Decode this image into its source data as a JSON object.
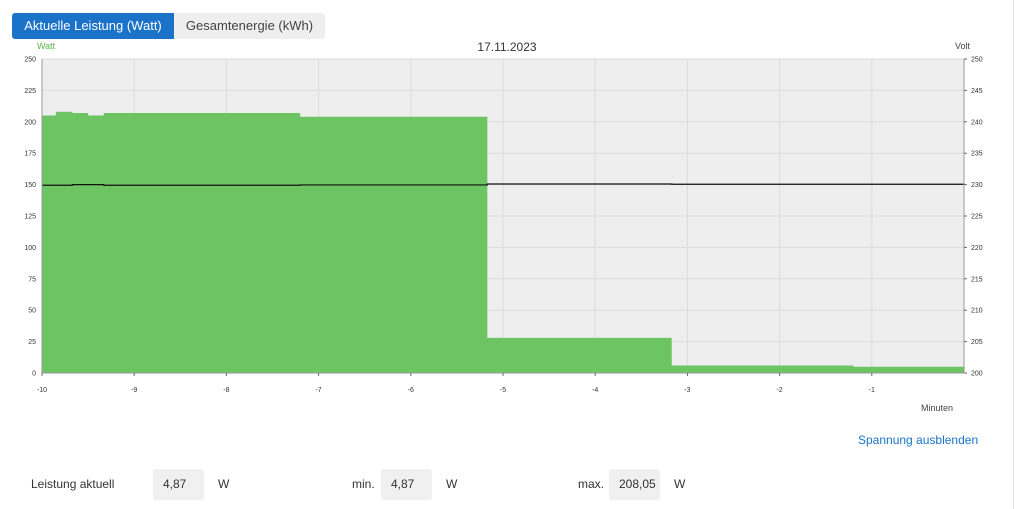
{
  "tabs": [
    {
      "label": "Aktuelle Leistung (Watt)",
      "active": true
    },
    {
      "label": "Gesamtenergie (kWh)",
      "active": false
    }
  ],
  "chart": {
    "title": "17.11.2023",
    "left_axis_label": "Watt",
    "right_axis_label": "Volt",
    "x_axis_label": "Minuten"
  },
  "chart_data": {
    "type": "area",
    "title": "17.11.2023",
    "xlabel": "Minuten",
    "ylabel": "Watt",
    "y2label": "Volt",
    "xlim": [
      -10,
      0
    ],
    "ylim": [
      0,
      250
    ],
    "y2lim": [
      200,
      250
    ],
    "x_ticks": [
      -10,
      -9,
      -8,
      -7,
      -6,
      -5,
      -4,
      -3,
      -2,
      -1
    ],
    "y_ticks": [
      0,
      25,
      50,
      75,
      100,
      125,
      150,
      175,
      200,
      225,
      250
    ],
    "y2_ticks": [
      200,
      205,
      210,
      215,
      220,
      225,
      230,
      235,
      240,
      245,
      250
    ],
    "grid": true,
    "series": [
      {
        "name": "Leistung",
        "axis": "left",
        "color": "#6cc462",
        "kind": "step-area",
        "x": [
          -10,
          -9.85,
          -9.67,
          -9.5,
          -9.33,
          -7.2,
          -5.17,
          -3.17,
          -1.2,
          0
        ],
        "y": [
          205,
          208,
          207,
          205,
          207,
          204,
          28,
          6,
          5,
          5
        ]
      },
      {
        "axis": "right",
        "color": "#111111",
        "kind": "step-line",
        "x": [
          -10,
          -9.67,
          -9.33,
          -7.2,
          -5.17,
          -3.17,
          0
        ],
        "y": [
          229.9,
          230,
          229.9,
          229.95,
          230.1,
          230.05,
          230
        ]
      }
    ]
  },
  "toggle_link": "Spannung ausblenden",
  "stats": {
    "current_label": "Leistung aktuell",
    "current_value": "4,87",
    "current_unit": "W",
    "min_label": "min.",
    "min_value": "4,87",
    "min_unit": "W",
    "max_label": "max.",
    "max_value": "208,05",
    "max_unit": "W"
  },
  "colors": {
    "accent": "#1a73c9",
    "area": "#6cc462",
    "plot_bg": "#eeeeee"
  }
}
